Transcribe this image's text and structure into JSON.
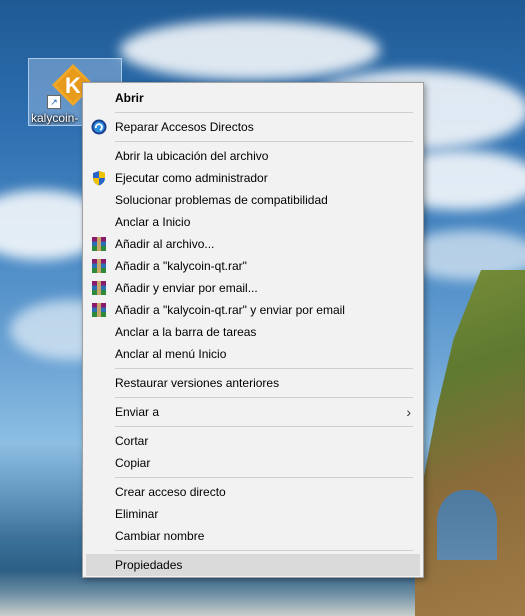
{
  "desktop": {
    "shortcut": {
      "label": "kalycoin-",
      "logo_letter": "K",
      "logo_color": "#f0a826"
    }
  },
  "context_menu": {
    "items": [
      {
        "label": "Abrir",
        "bold": true
      },
      {
        "label": "Reparar Accesos Directos",
        "icon": "repair-shortcut-icon"
      },
      {
        "label": "Abrir la ubicación del archivo"
      },
      {
        "label": "Ejecutar como administrador",
        "icon": "uac-shield-icon"
      },
      {
        "label": "Solucionar problemas de compatibilidad"
      },
      {
        "label": "Anclar a Inicio"
      },
      {
        "label": "Añadir al archivo...",
        "icon": "winrar-icon"
      },
      {
        "label": "Añadir a \"kalycoin-qt.rar\"",
        "icon": "winrar-icon"
      },
      {
        "label": "Añadir y enviar por email...",
        "icon": "winrar-icon"
      },
      {
        "label": "Añadir a \"kalycoin-qt.rar\" y enviar por email",
        "icon": "winrar-icon"
      },
      {
        "label": "Anclar a la barra de tareas"
      },
      {
        "label": "Anclar al menú Inicio"
      },
      {
        "label": "Restaurar versiones anteriores"
      },
      {
        "label": "Enviar a",
        "submenu": true
      },
      {
        "label": "Cortar"
      },
      {
        "label": "Copiar"
      },
      {
        "label": "Crear acceso directo"
      },
      {
        "label": "Eliminar"
      },
      {
        "label": "Cambiar nombre"
      },
      {
        "label": "Propiedades",
        "highlighted": true
      }
    ]
  },
  "colors": {
    "menu_bg": "#f2f2f2",
    "highlight": "#dadada"
  }
}
